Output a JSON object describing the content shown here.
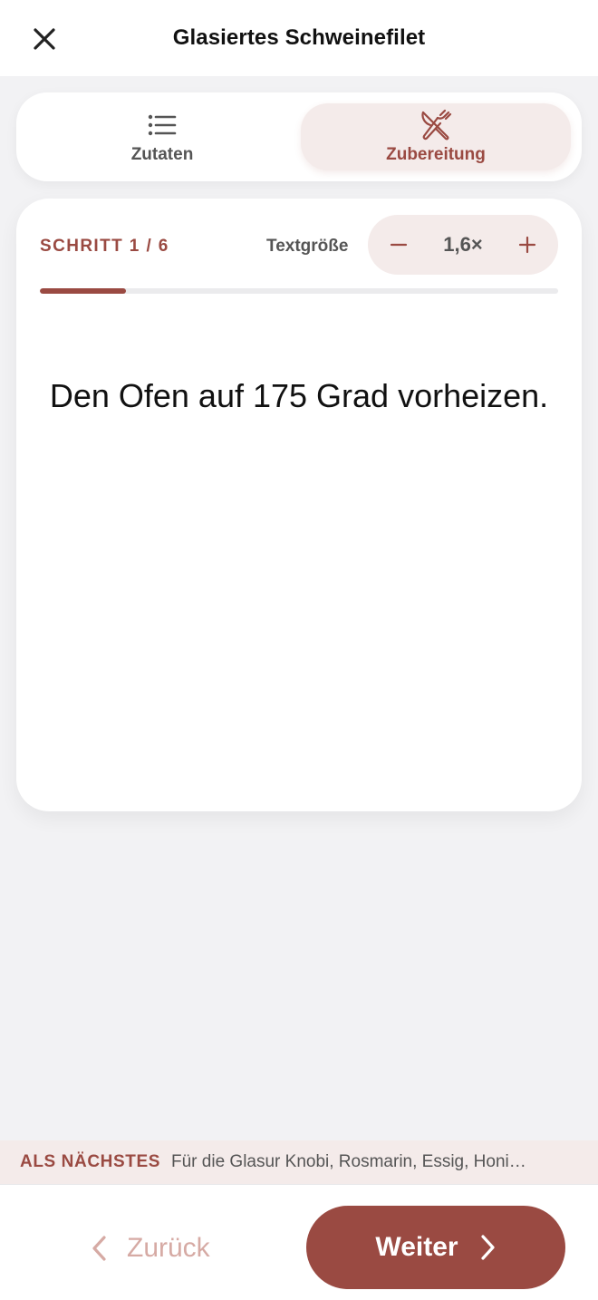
{
  "header": {
    "title": "Glasiertes Schweinefilet",
    "close_icon": "close-icon"
  },
  "tabs": [
    {
      "label": "Zutaten",
      "icon": "list-icon",
      "selected": false
    },
    {
      "label": "Zubereitung",
      "icon": "cutlery-icon",
      "selected": true
    }
  ],
  "step": {
    "label": "SCHRITT 1 / 6",
    "current": 1,
    "total": 6,
    "progress_fraction": 0.1667,
    "text": "Den Ofen auf 175 Grad vorheizen."
  },
  "textsize": {
    "label": "Textgröße",
    "value": "1,6×",
    "decrease_icon": "minus-icon",
    "increase_icon": "plus-icon"
  },
  "upnext": {
    "label": "ALS NÄCHSTES",
    "text": "Für die Glasur Knobi, Rosmarin, Essig, Honi…"
  },
  "nav": {
    "back_label": "Zurück",
    "next_label": "Weiter",
    "back_icon": "chevron-left-icon",
    "next_icon": "chevron-right-icon"
  },
  "colors": {
    "accent": "#9a4a42",
    "accent_light": "#f4ebea",
    "background": "#f2f2f4",
    "disabled_text": "#d6aaa4"
  }
}
